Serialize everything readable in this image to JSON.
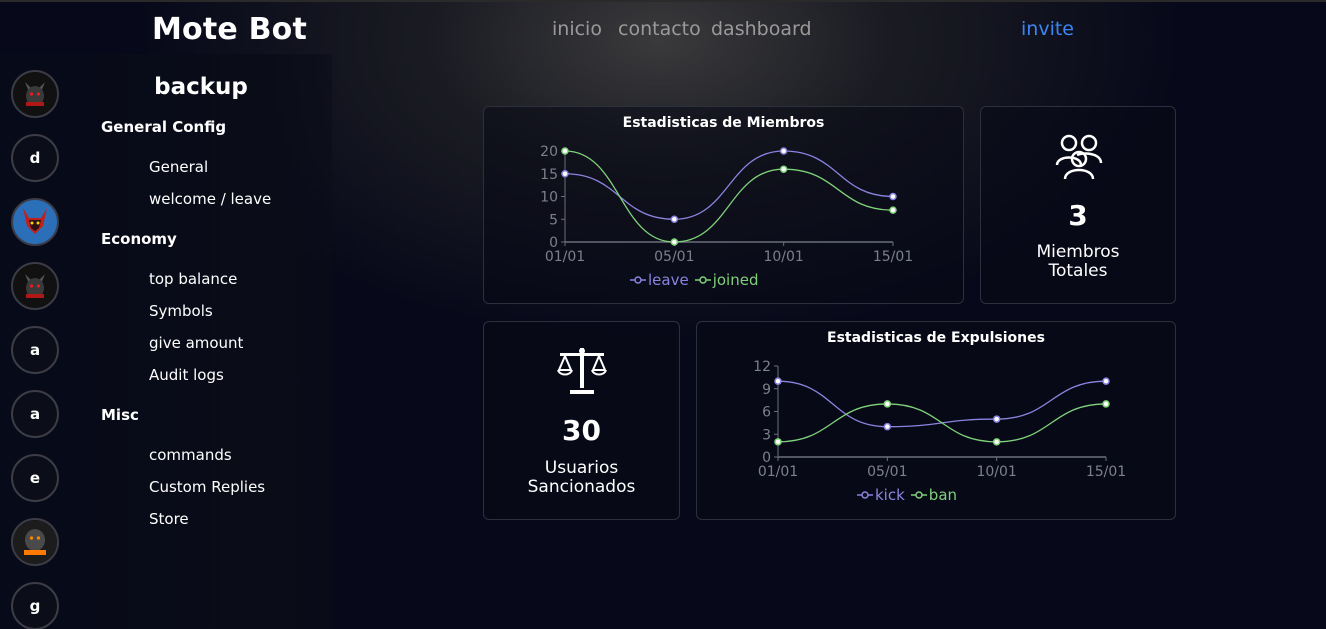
{
  "header": {
    "brand": "Mote Bot",
    "nav": [
      "inicio",
      "contacto",
      "dashboard"
    ],
    "invite": "invite"
  },
  "servers": [
    "",
    "d",
    "",
    "",
    "a",
    "a",
    "e",
    "",
    "g"
  ],
  "sidebar": {
    "title": "backup",
    "sections": [
      {
        "label": "General Config",
        "items": [
          "General",
          "welcome / leave"
        ]
      },
      {
        "label": "Economy",
        "items": [
          "top balance",
          "Symbols",
          "give amount",
          "Audit logs"
        ]
      },
      {
        "label": "Misc",
        "items": [
          "commands",
          "Custom Replies",
          "Store"
        ]
      }
    ]
  },
  "colors": {
    "series_a": "#8b83e0",
    "series_b": "#7fd17a",
    "accent": "#3b86f0"
  },
  "stats": {
    "members": {
      "value": "3",
      "label_line1": "Miembros",
      "label_line2": "Totales",
      "icon": "users-icon"
    },
    "sanctioned": {
      "value": "30",
      "label_line1": "Usuarios",
      "label_line2": "Sancionados",
      "icon": "scale-icon"
    }
  },
  "chart_data": [
    {
      "type": "line",
      "title": "Estadisticas de Miembros",
      "x": [
        "01/01",
        "05/01",
        "10/01",
        "15/01"
      ],
      "series": [
        {
          "name": "leave",
          "values": [
            15,
            5,
            20,
            10
          ]
        },
        {
          "name": "joined",
          "values": [
            20,
            0,
            16,
            7
          ]
        }
      ],
      "ylim": [
        0,
        20
      ],
      "yticks": [
        0,
        5,
        10,
        15,
        20
      ],
      "legend": "bottom"
    },
    {
      "type": "line",
      "title": "Estadisticas de Expulsiones",
      "x": [
        "01/01",
        "05/01",
        "10/01",
        "15/01"
      ],
      "series": [
        {
          "name": "kick",
          "values": [
            10,
            4,
            5,
            10
          ]
        },
        {
          "name": "ban",
          "values": [
            2,
            7,
            2,
            7
          ]
        }
      ],
      "ylim": [
        0,
        12
      ],
      "yticks": [
        0,
        3,
        6,
        9,
        12
      ],
      "legend": "bottom"
    }
  ]
}
